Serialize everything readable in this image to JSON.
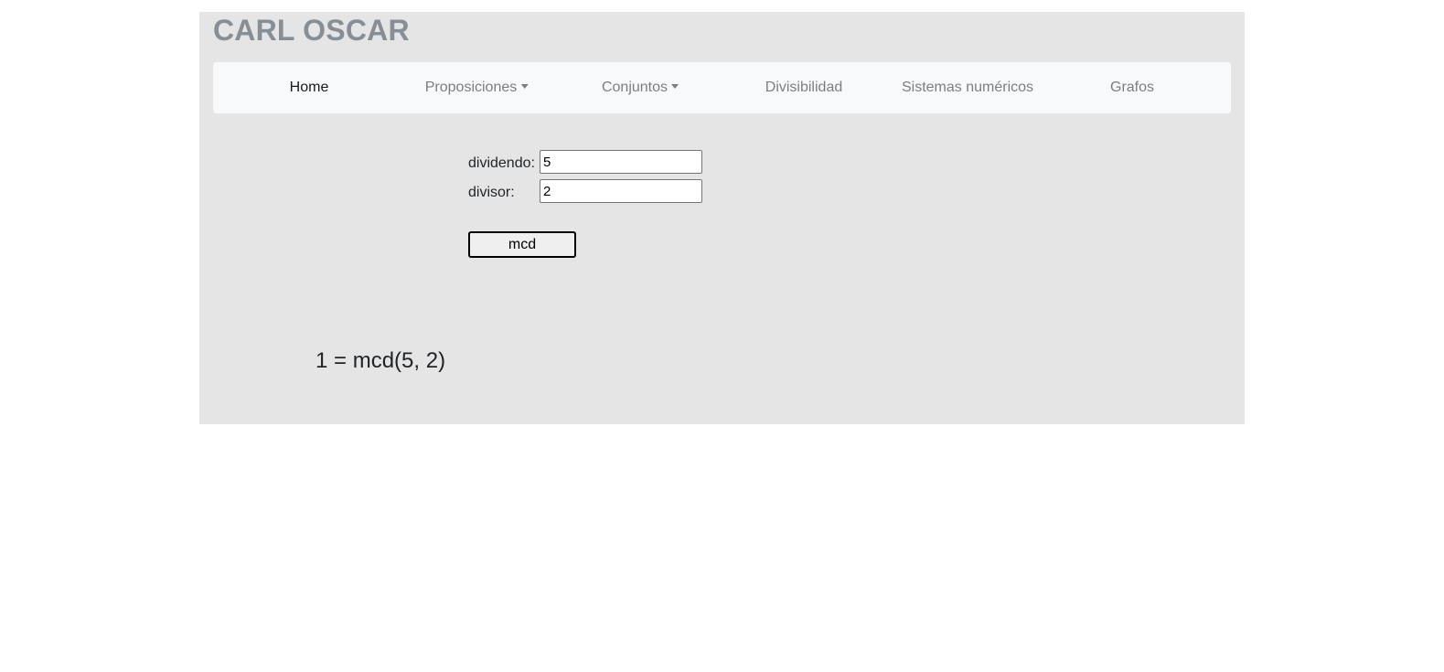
{
  "header": {
    "brand": "CARL OSCAR"
  },
  "navbar": {
    "items": [
      {
        "label": "Home",
        "active": true,
        "dropdown": false
      },
      {
        "label": "Proposiciones",
        "active": false,
        "dropdown": true
      },
      {
        "label": "Conjuntos",
        "active": false,
        "dropdown": true
      },
      {
        "label": "Divisibilidad",
        "active": false,
        "dropdown": false
      },
      {
        "label": "Sistemas numéricos",
        "active": false,
        "dropdown": false
      },
      {
        "label": "Grafos",
        "active": false,
        "dropdown": false
      }
    ]
  },
  "form": {
    "dividendo_label": "dividendo:",
    "dividendo_value": "5",
    "divisor_label": "divisor:",
    "divisor_value": "2",
    "submit_label": "mcd"
  },
  "result": {
    "text": "1 = mcd(5, 2)"
  },
  "colors": {
    "container_bg": "#e5e5e5",
    "navbar_bg": "#f8f9fa",
    "brand": "#868e96"
  }
}
